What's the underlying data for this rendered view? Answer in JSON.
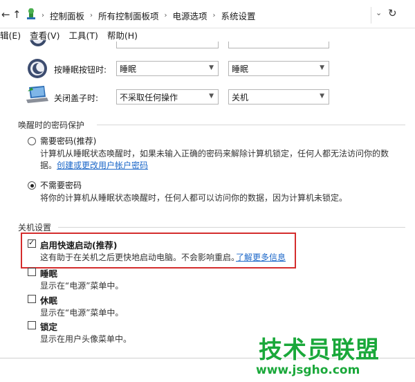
{
  "address": {
    "back": "←",
    "forward": "→",
    "up": "↑",
    "breadcrumbs": [
      "控制面板",
      "所有控制面板项",
      "电源选项",
      "系统设置"
    ],
    "refresh": "↻"
  },
  "menu": {
    "items": [
      "辑(E)",
      "查看(V)",
      "工具(T)",
      "帮助(H)"
    ]
  },
  "buttons": {
    "rows": [
      {
        "label": "按睡眠按钮时:",
        "battery": "睡眠",
        "plugged": "睡眠"
      },
      {
        "label": "关闭盖子时:",
        "battery": "不采取任何操作",
        "plugged": "关机"
      }
    ]
  },
  "password": {
    "header": "唤醒时的密码保护",
    "require_label": "需要密码(推荐)",
    "require_desc1": "计算机从睡眠状态唤醒时，如果未输入正确的密码来解除计算机锁定，任何人都无法访问你的数",
    "require_desc2": "据。",
    "require_link": "创建或更改用户帐户密码",
    "norequire_label": "不需要密码",
    "norequire_desc": "将你的计算机从睡眠状态唤醒时，任何人都可以访问你的数据，因为计算机未锁定。"
  },
  "shutdown": {
    "header": "关机设置",
    "fast_label": "启用快速启动(推荐)",
    "fast_desc": "这有助于在关机之后更快地启动电脑。不会影响重启。",
    "fast_link": "了解更多信息",
    "sleep_label": "睡眠",
    "sleep_desc": "显示在“电源”菜单中。",
    "hibernate_label": "休眠",
    "hibernate_desc": "显示在“电源”菜单中。",
    "lock_label": "锁定",
    "lock_desc": "显示在用户头像菜单中。"
  },
  "watermark": {
    "big": "技术员联盟",
    "small": "www.jsgho.com"
  }
}
